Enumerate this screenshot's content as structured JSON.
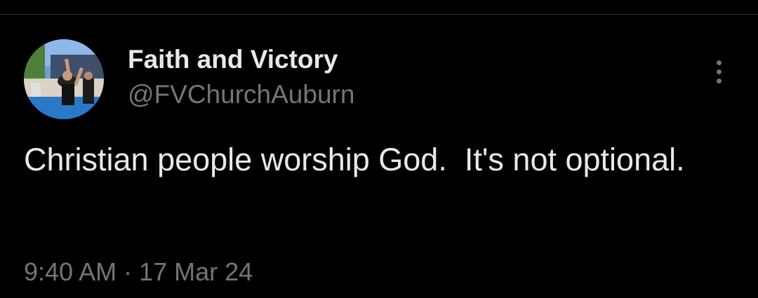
{
  "tweet": {
    "author": {
      "display_name": "Faith and Victory",
      "handle": "@FVChurchAuburn",
      "avatar_icon": "profile-photo"
    },
    "menu_icon": "more-vertical-icon",
    "text": "Christian people worship God.  It's not optional.",
    "timestamp": "9:40 AM · 17 Mar 24"
  },
  "colors": {
    "background": "#000000",
    "primary_text": "#e7e9ea",
    "secondary_text": "#71767b",
    "divider": "#2f3336"
  }
}
